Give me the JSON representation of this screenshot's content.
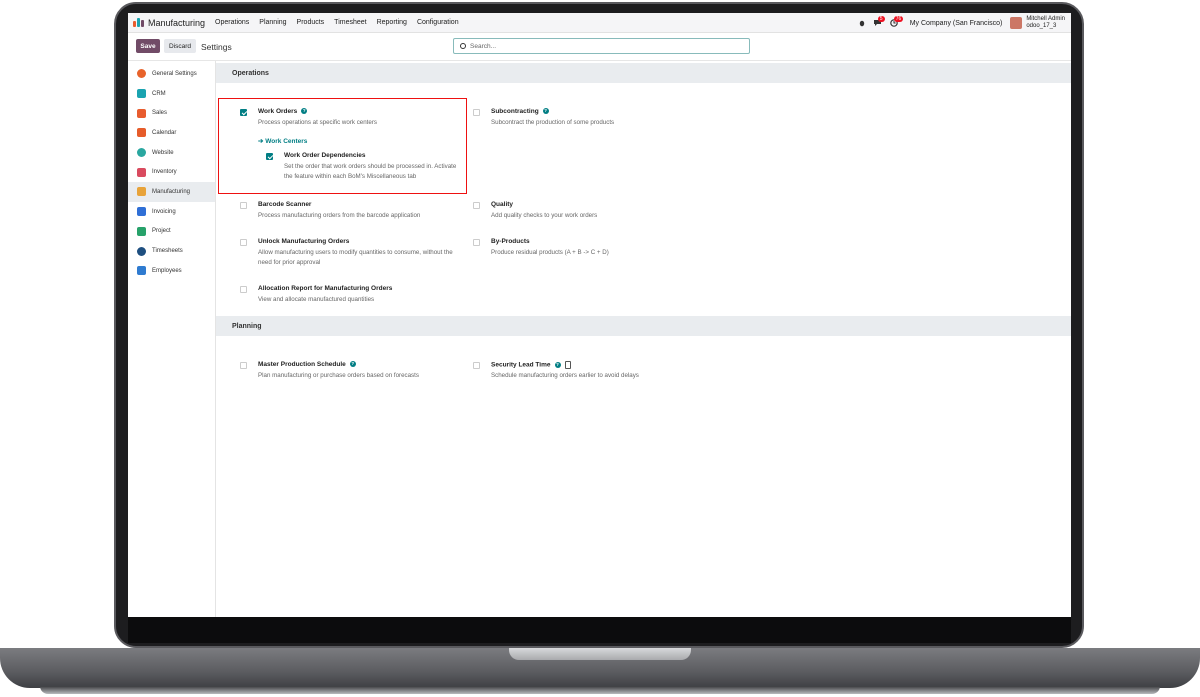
{
  "app": {
    "name": "Manufacturing"
  },
  "menu": [
    "Operations",
    "Planning",
    "Products",
    "Timesheet",
    "Reporting",
    "Configuration"
  ],
  "navbar": {
    "messages_badge": "5",
    "activities_badge": "76",
    "company": "My Company (San Francisco)",
    "user_name": "Mitchell Admin",
    "database": "odoo_17_3"
  },
  "control": {
    "save": "Save",
    "discard": "Discard",
    "title": "Settings",
    "search_placeholder": "Search..."
  },
  "sidebar": {
    "items": [
      {
        "label": "General Settings",
        "color": "#e8632b"
      },
      {
        "label": "CRM",
        "color": "#1aa3b0"
      },
      {
        "label": "Sales",
        "color": "#e85c2e"
      },
      {
        "label": "Calendar",
        "color": "#e65c2a"
      },
      {
        "label": "Website",
        "color": "#2aa7a0"
      },
      {
        "label": "Inventory",
        "color": "#d94b5f"
      },
      {
        "label": "Manufacturing",
        "color": "#e8a33a"
      },
      {
        "label": "Invoicing",
        "color": "#2f6fd6"
      },
      {
        "label": "Project",
        "color": "#27a26a"
      },
      {
        "label": "Timesheets",
        "color": "#1e4f80"
      },
      {
        "label": "Employees",
        "color": "#2f7bd0"
      }
    ]
  },
  "sections": {
    "operations": "Operations",
    "planning": "Planning"
  },
  "settings": {
    "work_orders": {
      "title": "Work Orders",
      "desc": "Process operations at specific work centers"
    },
    "work_centers_link": "➔ Work Centers",
    "work_order_dependencies": {
      "title": "Work Order Dependencies",
      "desc": "Set the order that work orders should be processed in. Activate the feature within each BoM's Miscellaneous tab"
    },
    "subcontracting": {
      "title": "Subcontracting",
      "desc": "Subcontract the production of some products"
    },
    "barcode_scanner": {
      "title": "Barcode Scanner",
      "desc": "Process manufacturing orders from the barcode application"
    },
    "quality": {
      "title": "Quality",
      "desc": "Add quality checks to your work orders"
    },
    "unlock_mo": {
      "title": "Unlock Manufacturing Orders",
      "desc": "Allow manufacturing users to modify quantities to consume, without the need for prior approval"
    },
    "by_products": {
      "title": "By-Products",
      "desc": "Produce residual products (A + B -> C + D)"
    },
    "allocation_report": {
      "title": "Allocation Report for Manufacturing Orders",
      "desc": "View and allocate manufactured quantities"
    },
    "mps": {
      "title": "Master Production Schedule",
      "desc": "Plan manufacturing or purchase orders based on forecasts"
    },
    "security_lead_time": {
      "title": "Security Lead Time",
      "desc": "Schedule manufacturing orders earlier to avoid delays"
    }
  },
  "colors": {
    "brand": "#714b67",
    "accent": "#017e84",
    "highlight": "#e11111"
  }
}
